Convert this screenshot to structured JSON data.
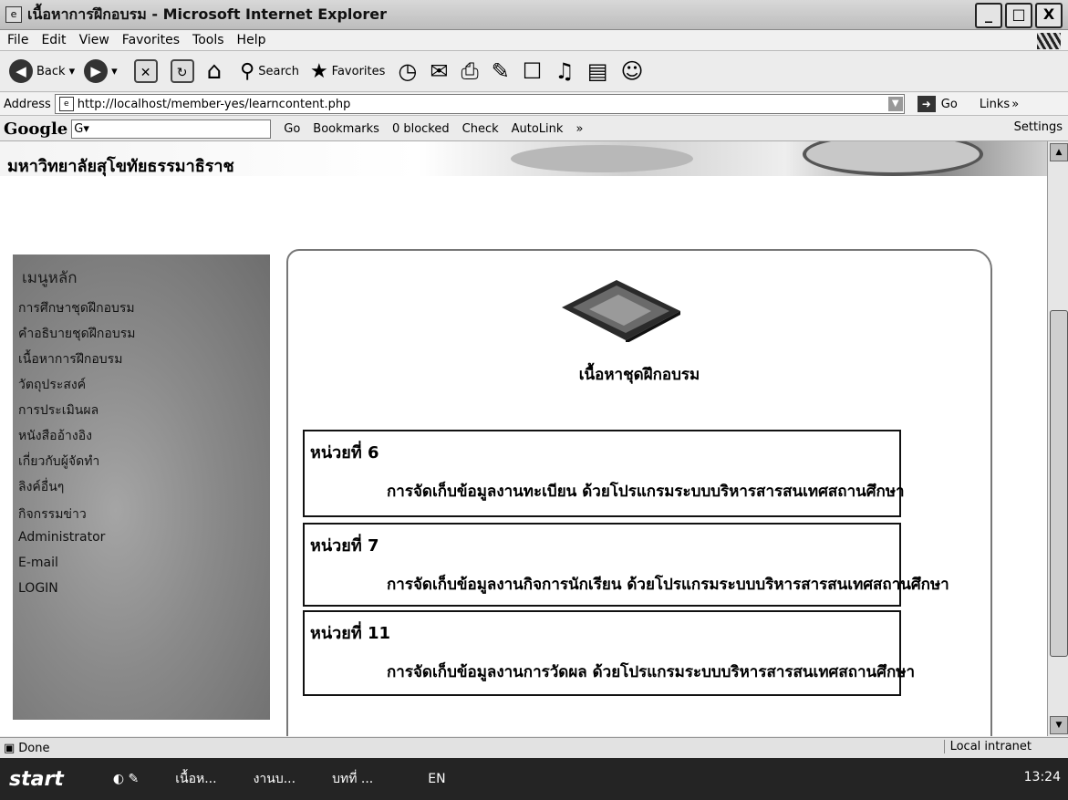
{
  "window": {
    "title": "เนื้อหาการฝึกอบรม - Microsoft Internet Explorer",
    "buttons": [
      "_",
      "□",
      "X"
    ]
  },
  "menu": [
    "File",
    "Edit",
    "View",
    "Favorites",
    "Tools",
    "Help"
  ],
  "toolbar": {
    "back": "Back",
    "search": "Search",
    "favorites": "Favorites"
  },
  "address": {
    "label": "Address",
    "url": "http://localhost/member-yes/learncontent.php",
    "go": "Go",
    "links": "Links"
  },
  "googlebar": {
    "logo": "Google",
    "box": "G▾",
    "go": "Go",
    "bookmarks": "Bookmarks",
    "blocked": "0 blocked",
    "check": "Check",
    "autolink": "AutoLink",
    "settings": "Settings"
  },
  "page": {
    "university": "มหาวิทยาลัยสุโขทัยธรรมาธิราช",
    "menu_heading": "เมนูหลัก",
    "menu_items": [
      "การศึกษาชุดฝึกอบรม",
      "คำอธิบายชุดฝึกอบรม",
      "เนื้อหาการฝึกอบรม",
      "วัตถุประสงค์",
      "การประเมินผล",
      "หนังสืออ้างอิง",
      "เกี่ยวกับผู้จัดทำ",
      "ลิงค์อื่นๆ",
      "กิจกรรมข่าว",
      "Administrator",
      "E-mail",
      "LOGIN"
    ],
    "content_title": "เนื้อหาชุดฝึกอบรม",
    "units": [
      {
        "head": "หน่วยที่ 6",
        "desc": "การจัดเก็บข้อมูลงานทะเบียน ด้วยโปรแกรมระบบบริหารสารสนเทศสถานศึกษา"
      },
      {
        "head": "หน่วยที่ 7",
        "desc": "การจัดเก็บข้อมูลงานกิจการนักเรียน ด้วยโปรแกรมระบบบริหารสารสนเทศสถานศึกษา"
      },
      {
        "head": "หน่วยที่ 11",
        "desc": "การจัดเก็บข้อมูลงานการวัดผล ด้วยโปรแกรมระบบบริหารสารสนเทศสถานศึกษา"
      }
    ]
  },
  "status": {
    "text": "Done",
    "zone": "Local intranet"
  },
  "taskbar": {
    "start": "start",
    "tasks": [
      "เนื้อห...",
      "งานบ...",
      "บทที่ ..."
    ],
    "lang": "EN",
    "time": "13:24"
  }
}
